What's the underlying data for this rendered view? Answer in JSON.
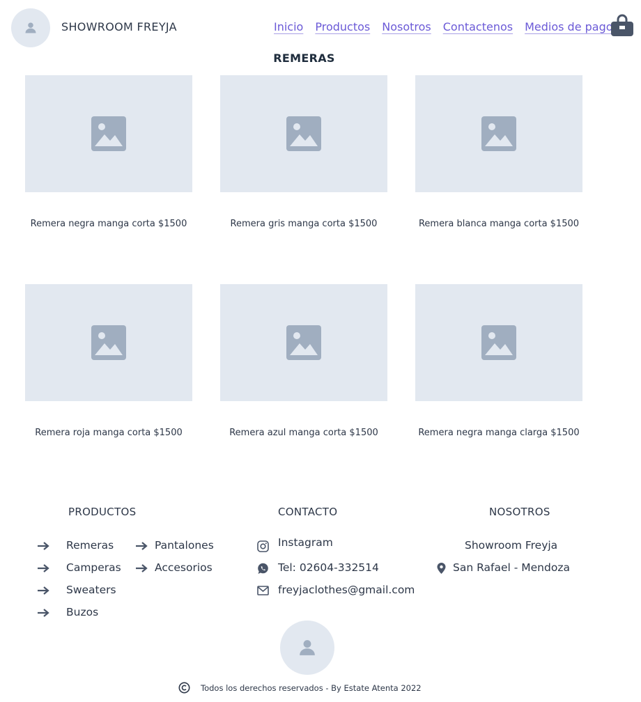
{
  "header": {
    "brand": "SHOWROOM FREYJA",
    "nav": [
      "Inicio",
      "Productos",
      "Nosotros",
      "Contactenos",
      "Medios de pago"
    ]
  },
  "section_title": "REMERAS",
  "products": [
    "Remera negra manga corta $1500",
    "Remera gris manga corta $1500",
    "Remera blanca manga corta $1500",
    "Remera roja manga corta $1500",
    "Remera azul manga corta $1500",
    "Remera negra manga clarga $1500"
  ],
  "footer": {
    "productos": {
      "title": "PRODUCTOS",
      "col1": [
        "Remeras",
        "Camperas",
        "Sweaters",
        "Buzos"
      ],
      "col2": [
        "Pantalones",
        "Accesorios"
      ]
    },
    "contacto": {
      "title": "CONTACTO",
      "instagram": "Instagram",
      "phone": "Tel: 02604-332514",
      "email": "freyjaclothes@gmail.com"
    },
    "nosotros": {
      "title": "NOSOTROS",
      "name": "Showroom Freyja",
      "location": "San Rafael - Mendoza"
    },
    "copyright": "Todos los derechos reservados - By Estate Atenta 2022"
  },
  "colors": {
    "link": "#6b5ad7",
    "placeholder_bg": "#e2e8f0",
    "placeholder_icon": "#a0aec0",
    "text": "#2d3748"
  },
  "icons": [
    "user-icon",
    "shopping-bag-icon",
    "image-placeholder-icon",
    "arrow-right-icon",
    "instagram-icon",
    "whatsapp-icon",
    "mail-icon",
    "map-pin-icon",
    "copyright-icon"
  ]
}
